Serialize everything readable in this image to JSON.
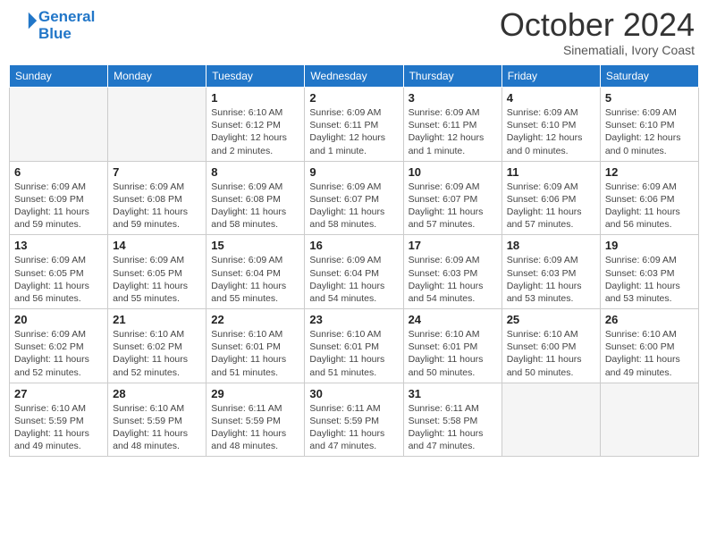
{
  "header": {
    "logo_line1": "General",
    "logo_line2": "Blue",
    "month": "October 2024",
    "location": "Sinematiali, Ivory Coast"
  },
  "weekdays": [
    "Sunday",
    "Monday",
    "Tuesday",
    "Wednesday",
    "Thursday",
    "Friday",
    "Saturday"
  ],
  "weeks": [
    [
      {
        "day": "",
        "info": ""
      },
      {
        "day": "",
        "info": ""
      },
      {
        "day": "1",
        "info": "Sunrise: 6:10 AM\nSunset: 6:12 PM\nDaylight: 12 hours and 2 minutes."
      },
      {
        "day": "2",
        "info": "Sunrise: 6:09 AM\nSunset: 6:11 PM\nDaylight: 12 hours and 1 minute."
      },
      {
        "day": "3",
        "info": "Sunrise: 6:09 AM\nSunset: 6:11 PM\nDaylight: 12 hours and 1 minute."
      },
      {
        "day": "4",
        "info": "Sunrise: 6:09 AM\nSunset: 6:10 PM\nDaylight: 12 hours and 0 minutes."
      },
      {
        "day": "5",
        "info": "Sunrise: 6:09 AM\nSunset: 6:10 PM\nDaylight: 12 hours and 0 minutes."
      }
    ],
    [
      {
        "day": "6",
        "info": "Sunrise: 6:09 AM\nSunset: 6:09 PM\nDaylight: 11 hours and 59 minutes."
      },
      {
        "day": "7",
        "info": "Sunrise: 6:09 AM\nSunset: 6:08 PM\nDaylight: 11 hours and 59 minutes."
      },
      {
        "day": "8",
        "info": "Sunrise: 6:09 AM\nSunset: 6:08 PM\nDaylight: 11 hours and 58 minutes."
      },
      {
        "day": "9",
        "info": "Sunrise: 6:09 AM\nSunset: 6:07 PM\nDaylight: 11 hours and 58 minutes."
      },
      {
        "day": "10",
        "info": "Sunrise: 6:09 AM\nSunset: 6:07 PM\nDaylight: 11 hours and 57 minutes."
      },
      {
        "day": "11",
        "info": "Sunrise: 6:09 AM\nSunset: 6:06 PM\nDaylight: 11 hours and 57 minutes."
      },
      {
        "day": "12",
        "info": "Sunrise: 6:09 AM\nSunset: 6:06 PM\nDaylight: 11 hours and 56 minutes."
      }
    ],
    [
      {
        "day": "13",
        "info": "Sunrise: 6:09 AM\nSunset: 6:05 PM\nDaylight: 11 hours and 56 minutes."
      },
      {
        "day": "14",
        "info": "Sunrise: 6:09 AM\nSunset: 6:05 PM\nDaylight: 11 hours and 55 minutes."
      },
      {
        "day": "15",
        "info": "Sunrise: 6:09 AM\nSunset: 6:04 PM\nDaylight: 11 hours and 55 minutes."
      },
      {
        "day": "16",
        "info": "Sunrise: 6:09 AM\nSunset: 6:04 PM\nDaylight: 11 hours and 54 minutes."
      },
      {
        "day": "17",
        "info": "Sunrise: 6:09 AM\nSunset: 6:03 PM\nDaylight: 11 hours and 54 minutes."
      },
      {
        "day": "18",
        "info": "Sunrise: 6:09 AM\nSunset: 6:03 PM\nDaylight: 11 hours and 53 minutes."
      },
      {
        "day": "19",
        "info": "Sunrise: 6:09 AM\nSunset: 6:03 PM\nDaylight: 11 hours and 53 minutes."
      }
    ],
    [
      {
        "day": "20",
        "info": "Sunrise: 6:09 AM\nSunset: 6:02 PM\nDaylight: 11 hours and 52 minutes."
      },
      {
        "day": "21",
        "info": "Sunrise: 6:10 AM\nSunset: 6:02 PM\nDaylight: 11 hours and 52 minutes."
      },
      {
        "day": "22",
        "info": "Sunrise: 6:10 AM\nSunset: 6:01 PM\nDaylight: 11 hours and 51 minutes."
      },
      {
        "day": "23",
        "info": "Sunrise: 6:10 AM\nSunset: 6:01 PM\nDaylight: 11 hours and 51 minutes."
      },
      {
        "day": "24",
        "info": "Sunrise: 6:10 AM\nSunset: 6:01 PM\nDaylight: 11 hours and 50 minutes."
      },
      {
        "day": "25",
        "info": "Sunrise: 6:10 AM\nSunset: 6:00 PM\nDaylight: 11 hours and 50 minutes."
      },
      {
        "day": "26",
        "info": "Sunrise: 6:10 AM\nSunset: 6:00 PM\nDaylight: 11 hours and 49 minutes."
      }
    ],
    [
      {
        "day": "27",
        "info": "Sunrise: 6:10 AM\nSunset: 5:59 PM\nDaylight: 11 hours and 49 minutes."
      },
      {
        "day": "28",
        "info": "Sunrise: 6:10 AM\nSunset: 5:59 PM\nDaylight: 11 hours and 48 minutes."
      },
      {
        "day": "29",
        "info": "Sunrise: 6:11 AM\nSunset: 5:59 PM\nDaylight: 11 hours and 48 minutes."
      },
      {
        "day": "30",
        "info": "Sunrise: 6:11 AM\nSunset: 5:59 PM\nDaylight: 11 hours and 47 minutes."
      },
      {
        "day": "31",
        "info": "Sunrise: 6:11 AM\nSunset: 5:58 PM\nDaylight: 11 hours and 47 minutes."
      },
      {
        "day": "",
        "info": ""
      },
      {
        "day": "",
        "info": ""
      }
    ]
  ]
}
